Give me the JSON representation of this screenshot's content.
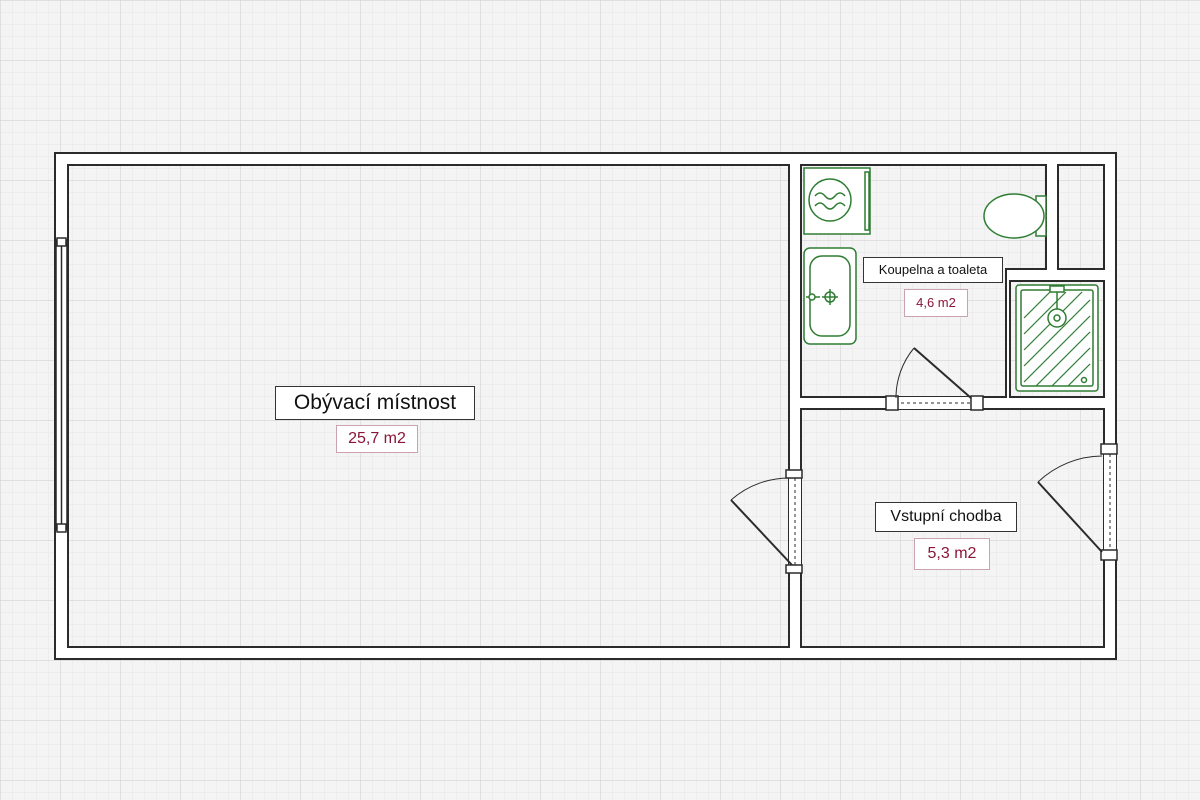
{
  "colors": {
    "wall": "#2b2b2b",
    "wall_fill": "#ffffff",
    "fixture": "#2e7d32",
    "area_text": "#8a1538",
    "grid_major": "#d2d2d2",
    "grid_minor": "#e6e6e6"
  },
  "rooms": [
    {
      "key": "living",
      "name": "Obývací místnost",
      "area": "25,7 m2"
    },
    {
      "key": "bathroom",
      "name": "Koupelna a toaleta",
      "area": "4,6 m2"
    },
    {
      "key": "hallway",
      "name": "Vstupní chodba",
      "area": "5,3 m2"
    }
  ],
  "fixtures": [
    "washing-machine-icon",
    "toilet-icon",
    "sink-icon",
    "shower-icon"
  ]
}
